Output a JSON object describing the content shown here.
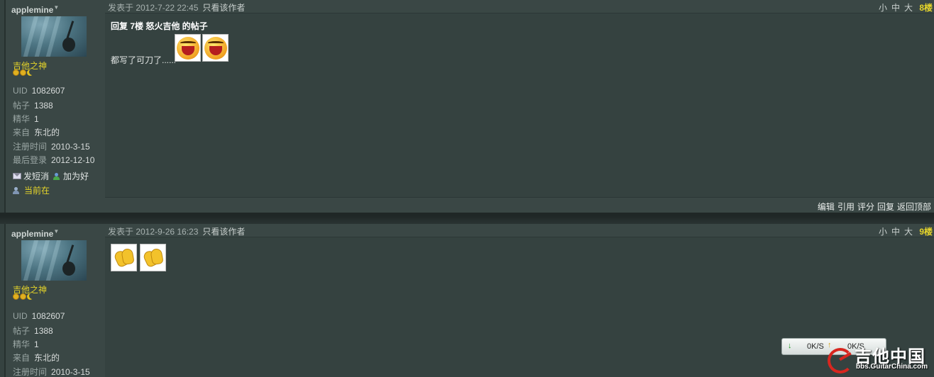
{
  "posts": [
    {
      "author": "applemine",
      "rank": "吉他之神",
      "info": [
        {
          "k": "UID",
          "v": "1082607"
        },
        {
          "k": "帖子",
          "v": "1388"
        },
        {
          "k": "精华",
          "v": "1"
        },
        {
          "k": "来自",
          "v": "东北的"
        },
        {
          "k": "注册时间",
          "v": "2010-3-15"
        },
        {
          "k": "最后登录",
          "v": "2012-12-10"
        }
      ],
      "send_msg": "发短消",
      "add_friend": "加为好",
      "online": "当前在",
      "date": "发表于 2012-7-22 22:45",
      "only_author": "只看该作者",
      "size_small": "小",
      "size_mid": "中",
      "size_large": "大",
      "floor": "8楼",
      "reply_title": "回复 7楼 怒火吉他 的帖子",
      "message": "都写了可刀了......",
      "emojis": [
        "laugh-emoji",
        "laugh-emoji"
      ],
      "footer": [
        "编辑",
        "引用",
        "评分",
        "回复",
        "返回顶部"
      ]
    },
    {
      "author": "applemine",
      "rank": "吉他之神",
      "info": [
        {
          "k": "UID",
          "v": "1082607"
        },
        {
          "k": "帖子",
          "v": "1388"
        },
        {
          "k": "精华",
          "v": "1"
        },
        {
          "k": "来自",
          "v": "东北的"
        },
        {
          "k": "注册时间",
          "v": "2010-3-15"
        }
      ],
      "date": "发表于 2012-9-26 16:23",
      "only_author": "只看该作者",
      "size_small": "小",
      "size_mid": "中",
      "size_large": "大",
      "floor": "9楼",
      "emojis": [
        "clap-emoji",
        "clap-emoji"
      ]
    }
  ],
  "speed_widget": {
    "down": "0K/S",
    "up": "0K/S",
    "down_icon": "arrow-down",
    "up_icon": "arrow-up"
  },
  "watermark": {
    "title": "吉他中国",
    "url": "bbs.GuitarChina.com"
  },
  "colors": {
    "background": "#354240",
    "rank": "#e6d52a",
    "floor": "#e6d52a"
  }
}
